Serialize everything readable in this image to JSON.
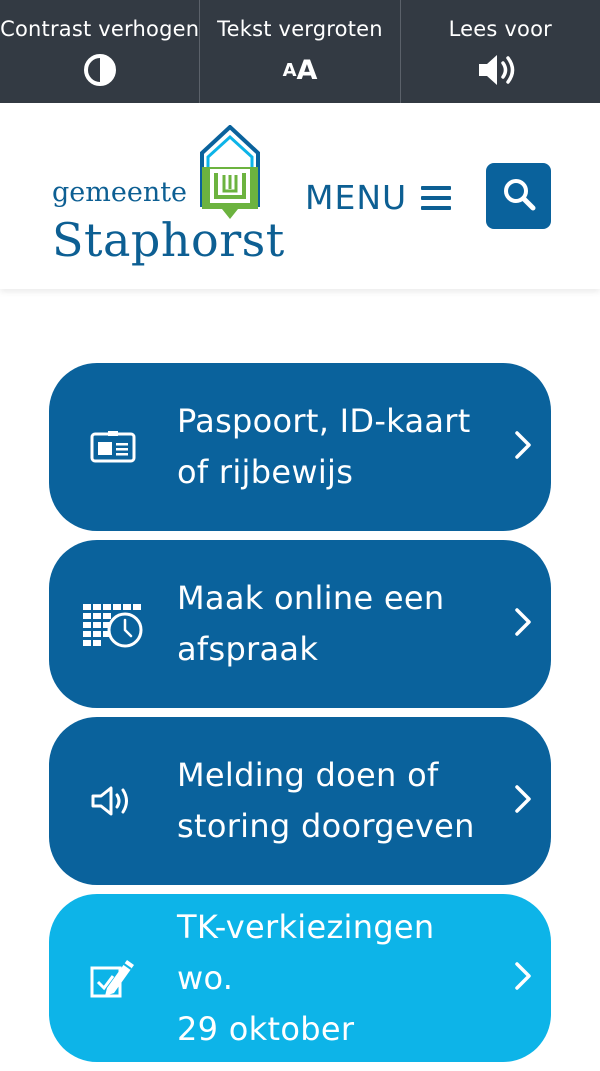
{
  "toolbar": {
    "contrast_label": "Contrast verhogen",
    "contrast_icon": "contrast-icon",
    "text_label": "Tekst vergroten",
    "text_icon_small": "A",
    "text_icon_big": "A",
    "read_label": "Lees voor",
    "read_icon": "speaker-icon"
  },
  "header": {
    "logo_small": "gemeente",
    "logo_big": "Staphorst",
    "menu_label": "MENU",
    "search_icon": "search-icon"
  },
  "tiles": [
    {
      "label_line1": "Paspoort, ID-kaart",
      "label_line2": "of rijbewijs",
      "icon": "id-card-icon"
    },
    {
      "label_line1": "Maak online een",
      "label_line2": "afspraak",
      "icon": "calendar-clock-icon"
    },
    {
      "label_line1": "Melding doen of",
      "label_line2": "storing doorgeven",
      "icon": "megaphone-icon"
    },
    {
      "label_line1": "TK-verkiezingen wo.",
      "label_line2": "29 oktober",
      "icon": "ballot-pencil-icon"
    }
  ],
  "colors": {
    "topbar": "#333a43",
    "brand_blue": "#0a629c",
    "light_blue": "#0db4e8",
    "logo_green": "#6cb33f"
  }
}
